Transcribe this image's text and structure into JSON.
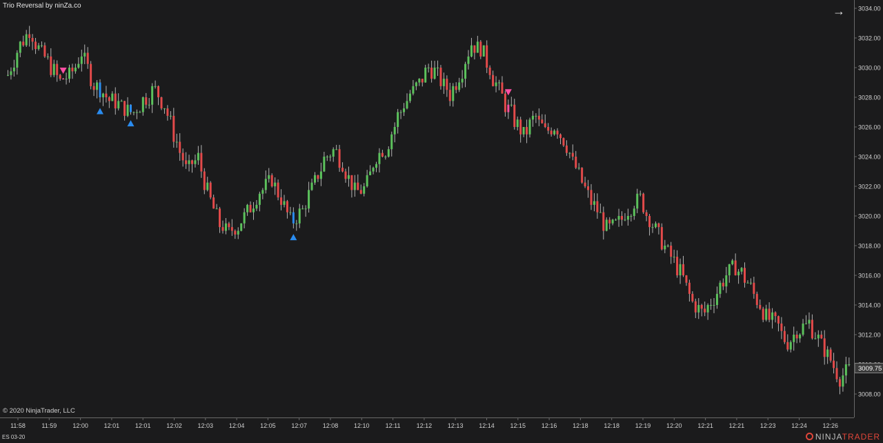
{
  "header": {
    "title": "Trio Reversal by ninZa.co"
  },
  "footer": {
    "copyright": "© 2020 NinjaTrader, LLC",
    "instrument": "ES 03-20"
  },
  "brand": {
    "part1": "NINJA",
    "part2": "TRADER"
  },
  "icons": {
    "arrow": "arrow-right-icon"
  },
  "chart_data": {
    "type": "candlestick",
    "y_ticks": [
      3034,
      3032,
      3030,
      3028,
      3026,
      3024,
      3022,
      3020,
      3018,
      3016,
      3014,
      3012,
      3010,
      3008
    ],
    "y_tick_labels": [
      "3034.00",
      "3032.00",
      "3030.00",
      "3028.00",
      "3026.00",
      "3024.00",
      "3022.00",
      "3020.00",
      "3018.00",
      "3016.00",
      "3014.00",
      "3012.00",
      "3010.00",
      "3008.00"
    ],
    "ylim": [
      3007.3,
      3034.5
    ],
    "x_labels": [
      "11:58",
      "11:59",
      "12:00",
      "12:01",
      "12:01",
      "12:02",
      "12:03",
      "12:04",
      "12:05",
      "12:07",
      "12:08",
      "12:10",
      "12:11",
      "12:12",
      "12:13",
      "12:14",
      "12:15",
      "12:16",
      "12:18",
      "12:18",
      "12:19",
      "12:20",
      "12:21",
      "12:21",
      "12:23",
      "12:24",
      "12:26"
    ],
    "last_price": "3009.75",
    "bar_count": 275,
    "colors": {
      "up": "#5cc25c",
      "down": "#e34a4a",
      "signal_sell": "#ff4fa3",
      "signal_buy": "#2a8cf0",
      "wick": "#b4b4b4",
      "last_price_bg": "#3a3a3a"
    },
    "path": [
      [
        0,
        3029.5
      ],
      [
        7,
        3031.3
      ],
      [
        14,
        3032.6
      ],
      [
        21,
        3031.2
      ],
      [
        28,
        3030.2
      ],
      [
        35,
        3029.1
      ],
      [
        42,
        3029.6
      ],
      [
        49,
        3031.0
      ],
      [
        56,
        3029.0
      ],
      [
        63,
        3028.3
      ],
      [
        70,
        3027.6
      ],
      [
        77,
        3027.3
      ],
      [
        84,
        3027.0
      ],
      [
        91,
        3027.9
      ],
      [
        98,
        3028.6
      ],
      [
        105,
        3027.2
      ],
      [
        112,
        3025.0
      ],
      [
        119,
        3023.0
      ],
      [
        126,
        3024.0
      ],
      [
        133,
        3021.5
      ],
      [
        140,
        3019.5
      ],
      [
        147,
        3018.8
      ],
      [
        154,
        3019.5
      ],
      [
        161,
        3020.6
      ],
      [
        168,
        3021.7
      ],
      [
        175,
        3022.5
      ],
      [
        182,
        3021.0
      ],
      [
        189,
        3019.5
      ],
      [
        196,
        3020.5
      ],
      [
        203,
        3022.0
      ],
      [
        210,
        3023.8
      ],
      [
        217,
        3024.6
      ],
      [
        224,
        3023.2
      ],
      [
        231,
        3021.5
      ],
      [
        238,
        3022.0
      ],
      [
        245,
        3024.2
      ],
      [
        252,
        3024.6
      ],
      [
        259,
        3026.7
      ],
      [
        266,
        3028.0
      ],
      [
        273,
        3028.9
      ],
      [
        280,
        3030.1
      ],
      [
        287,
        3029.3
      ],
      [
        294,
        3028.2
      ],
      [
        301,
        3029.6
      ],
      [
        308,
        3031.6
      ],
      [
        315,
        3031.2
      ],
      [
        322,
        3029.4
      ],
      [
        329,
        3027.8
      ],
      [
        336,
        3026.6
      ],
      [
        343,
        3025.3
      ],
      [
        350,
        3026.8
      ],
      [
        357,
        3025.6
      ],
      [
        364,
        3026.0
      ],
      [
        371,
        3024.8
      ],
      [
        378,
        3023.0
      ],
      [
        385,
        3021.5
      ],
      [
        392,
        3020.2
      ],
      [
        399,
        3019.0
      ],
      [
        406,
        3019.5
      ],
      [
        413,
        3020.6
      ],
      [
        420,
        3021.2
      ],
      [
        427,
        3019.6
      ],
      [
        434,
        3018.3
      ],
      [
        441,
        3017.2
      ],
      [
        448,
        3016.0
      ],
      [
        455,
        3014.2
      ],
      [
        462,
        3013.4
      ],
      [
        469,
        3014.4
      ],
      [
        476,
        3015.8
      ],
      [
        483,
        3016.6
      ],
      [
        490,
        3015.8
      ],
      [
        497,
        3014.4
      ],
      [
        504,
        3013.2
      ],
      [
        511,
        3012.6
      ],
      [
        518,
        3011.5
      ],
      [
        525,
        3012.3
      ],
      [
        532,
        3012.8
      ],
      [
        539,
        3011.6
      ],
      [
        546,
        3010.3
      ],
      [
        553,
        3009.1
      ],
      [
        560,
        3009.8
      ]
    ],
    "signals": [
      {
        "bar": 18,
        "dir": "sell"
      },
      {
        "bar": 30,
        "dir": "buy"
      },
      {
        "bar": 40,
        "dir": "buy"
      },
      {
        "bar": 93,
        "dir": "buy"
      },
      {
        "bar": 163,
        "dir": "sell"
      }
    ]
  }
}
